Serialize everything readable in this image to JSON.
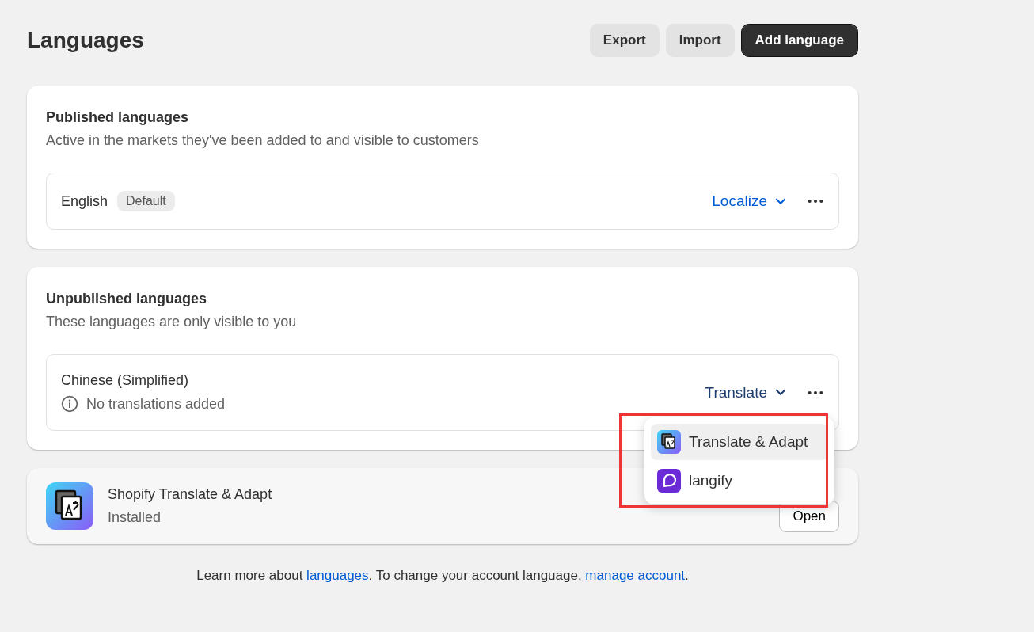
{
  "page": {
    "title": "Languages"
  },
  "header_buttons": [
    {
      "label": "Export",
      "kind": "secondary"
    },
    {
      "label": "Import",
      "kind": "secondary"
    },
    {
      "label": "Add language",
      "kind": "primary"
    }
  ],
  "sections": [
    {
      "title": "Published languages",
      "description": "Active in the markets they've been added to and visible to customers",
      "languages": [
        {
          "name": "English",
          "badge": "Default",
          "action": "Localize"
        }
      ]
    },
    {
      "title": "Unpublished languages",
      "description": "These languages are only visible to you",
      "languages": [
        {
          "name": "Chinese (Simplified)",
          "action": "Translate",
          "note": "No translations added"
        }
      ]
    }
  ],
  "app": {
    "name": "Shopify Translate & Adapt",
    "status": "Installed",
    "button": "Open"
  },
  "menu": {
    "items": [
      {
        "label": "Translate & Adapt",
        "selected": true
      },
      {
        "label": "langify",
        "selected": false
      }
    ]
  },
  "footer": {
    "text_before": "Learn more about ",
    "link1": "languages",
    "text_middle": ". To change your account language, ",
    "link2": "manage account",
    "text_after": "."
  }
}
